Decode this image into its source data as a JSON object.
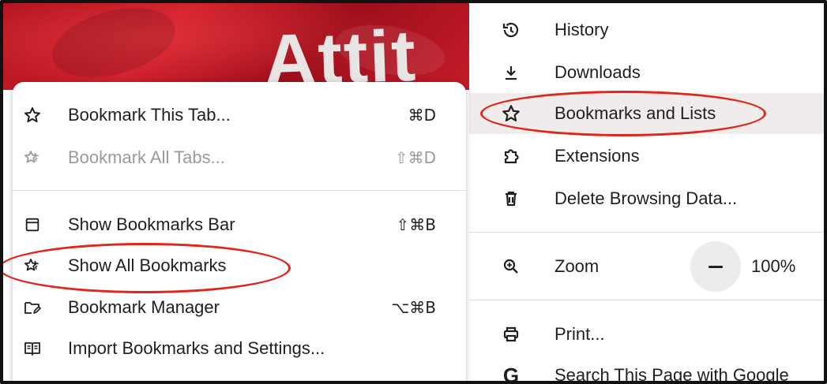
{
  "background": {
    "photo_text": "Attit",
    "accent_color": "#c51b28"
  },
  "main_menu": {
    "items": [
      {
        "label": "History",
        "icon": "history-icon"
      },
      {
        "label": "Downloads",
        "icon": "download-icon"
      },
      {
        "label": "Bookmarks and Lists",
        "icon": "star-icon",
        "highlighted": true
      },
      {
        "label": "Extensions",
        "icon": "puzzle-icon"
      },
      {
        "label": "Delete Browsing Data...",
        "icon": "trash-icon"
      },
      {
        "label": "Zoom",
        "icon": "zoom-icon",
        "zoom_value": "100%"
      },
      {
        "label": "Print...",
        "icon": "printer-icon"
      },
      {
        "label": "Search This Page with Google",
        "icon": "google-icon"
      }
    ]
  },
  "bookmarks_submenu": {
    "items": [
      {
        "label": "Bookmark This Tab...",
        "shortcut": "⌘D",
        "icon": "star-icon"
      },
      {
        "label": "Bookmark All Tabs...",
        "shortcut": "⇧⌘D",
        "icon": "stars-icon",
        "disabled": true
      },
      {
        "label": "Show Bookmarks Bar",
        "shortcut": "⇧⌘B",
        "icon": "window-icon"
      },
      {
        "label": "Show All Bookmarks",
        "shortcut": "",
        "icon": "stars-icon"
      },
      {
        "label": "Bookmark Manager",
        "shortcut": "⌥⌘B",
        "icon": "folder-edit-icon"
      },
      {
        "label": "Import Bookmarks and Settings...",
        "shortcut": "",
        "icon": "book-icon"
      }
    ]
  },
  "annotation_color": "#e0251b"
}
